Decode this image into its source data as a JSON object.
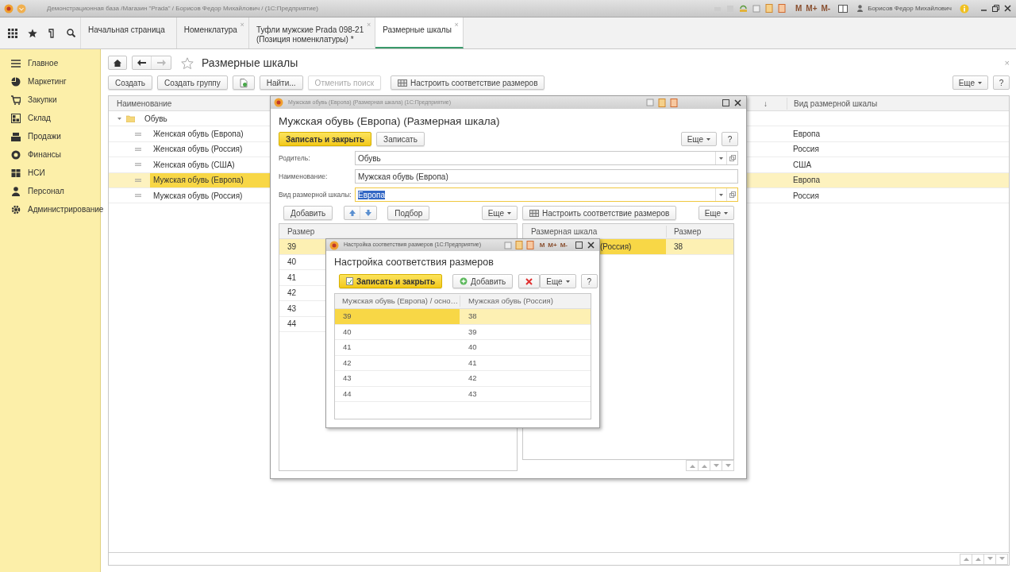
{
  "app": {
    "title": "Демонстрационная база /Магазин \"Prada\" / Борисов Федор Михайлович / (1С:Предприятие)",
    "memory": [
      "M",
      "M+",
      "M-"
    ],
    "user": "Борисов Федор Михайлович"
  },
  "tabs": [
    {
      "label": "Начальная страница",
      "selected": false
    },
    {
      "label": "Номенклатура",
      "close": "×",
      "selected": false
    },
    {
      "label": "Туфли мужские Prada 098-21\n(Позиция номенклатуры) *",
      "close": "×",
      "selected": false
    },
    {
      "label": "Размерные шкалы",
      "close": "×",
      "selected": true
    }
  ],
  "sidebar": [
    {
      "label": "Главное"
    },
    {
      "label": "Маркетинг"
    },
    {
      "label": "Закупки"
    },
    {
      "label": "Склад"
    },
    {
      "label": "Продажи"
    },
    {
      "label": "Финансы"
    },
    {
      "label": "НСИ"
    },
    {
      "label": "Персонал"
    },
    {
      "label": "Администрирование"
    }
  ],
  "page": {
    "title": "Размерные шкалы",
    "close": "×",
    "toolbar": [
      {
        "label": "Создать",
        "kind": "normal",
        "disabled": false
      },
      {
        "label": "Создать группу",
        "kind": "normal",
        "disabled": false
      },
      {
        "kind": "doc",
        "disabled": false
      },
      {
        "label": "Найти...",
        "kind": "normal",
        "disabled": false
      },
      {
        "label": "Отменить поиск",
        "kind": "normal",
        "disabled": true
      },
      {
        "label": "Настроить соответствие размеров",
        "kind": "match",
        "disabled": false
      }
    ],
    "more": "Еще",
    "help": "?",
    "columns": [
      "Наименование",
      "↓",
      "Вид размерной шкалы"
    ],
    "tree": [
      {
        "label": "Обувь",
        "expanded": true,
        "selected": false,
        "children": [
          {
            "label": "Женская обувь (Европа)",
            "type": "Европа",
            "selected": false
          },
          {
            "label": "Женская обувь (Россия)",
            "type": "Россия",
            "selected": false
          },
          {
            "label": "Женская обувь (США)",
            "type": "США",
            "selected": false
          },
          {
            "label": "Мужская обувь (Европа)",
            "type": "Европа",
            "selected": true
          },
          {
            "label": "Мужская обувь (Россия)",
            "type": "Россия",
            "selected": false
          }
        ]
      }
    ]
  },
  "form": {
    "window_title": "Мужская обувь (Европа) (Размерная шкала)  (1С:Предприятие)",
    "heading": "Мужская обувь (Европа) (Размерная шкала)",
    "buttons": [
      {
        "label": "Записать и закрыть",
        "kind": "primary"
      },
      {
        "label": "Записать",
        "kind": "normal"
      }
    ],
    "more": "Еще",
    "help": "?",
    "fields": [
      {
        "label": "Родитель:",
        "value": "Обувь",
        "dropdown": true,
        "focused": false
      },
      {
        "label": "Наименование:",
        "value": "Мужская обувь (Европа)",
        "dropdown": false,
        "focused": false
      },
      {
        "label": "Вид размерной шкалы:",
        "value": "Европа",
        "dropdown": true,
        "focused": true
      }
    ],
    "left_toolbar": [
      {
        "label": "Добавить",
        "kind": "normal"
      },
      {
        "kind": "arrows"
      },
      {
        "label": "Подбор",
        "kind": "normal"
      }
    ],
    "left_more": "Еще",
    "right_toolbar": [
      {
        "label": "Настроить соответствие размеров",
        "kind": "match"
      }
    ],
    "right_more": "Еще",
    "sizes": {
      "column": "Размер",
      "rows": [
        {
          "size": "39",
          "selected": true
        },
        {
          "size": "40",
          "selected": false
        },
        {
          "size": "41",
          "selected": false
        },
        {
          "size": "42",
          "selected": false
        },
        {
          "size": "43",
          "selected": false
        },
        {
          "size": "44",
          "selected": false
        }
      ]
    },
    "matches": {
      "columns": [
        "Размерная шкала",
        "Размер"
      ],
      "rows": [
        {
          "scale": "(Россия)",
          "size": "38",
          "selected": true
        }
      ]
    }
  },
  "dialog": {
    "window_title": "Настройка соответствия размеров  (1С:Предприятие)",
    "memory": [
      "M",
      "M+",
      "M-"
    ],
    "heading": "Настройка соответствия размеров",
    "buttons": [
      {
        "label": "Записать и закрыть",
        "kind": "primary"
      },
      {
        "label": "Добавить",
        "kind": "add"
      },
      {
        "kind": "delete"
      }
    ],
    "more": "Еще",
    "help": "?",
    "columns": [
      "Мужская обувь (Европа) / осно…",
      "Мужская обувь (Россия)"
    ],
    "rows": [
      {
        "cells": [
          "39",
          "38"
        ],
        "selected": true
      },
      {
        "cells": [
          "40",
          "39"
        ],
        "selected": false
      },
      {
        "cells": [
          "41",
          "40"
        ],
        "selected": false
      },
      {
        "cells": [
          "42",
          "41"
        ],
        "selected": false
      },
      {
        "cells": [
          "43",
          "42"
        ],
        "selected": false
      },
      {
        "cells": [
          "44",
          "43"
        ],
        "selected": false
      }
    ]
  }
}
